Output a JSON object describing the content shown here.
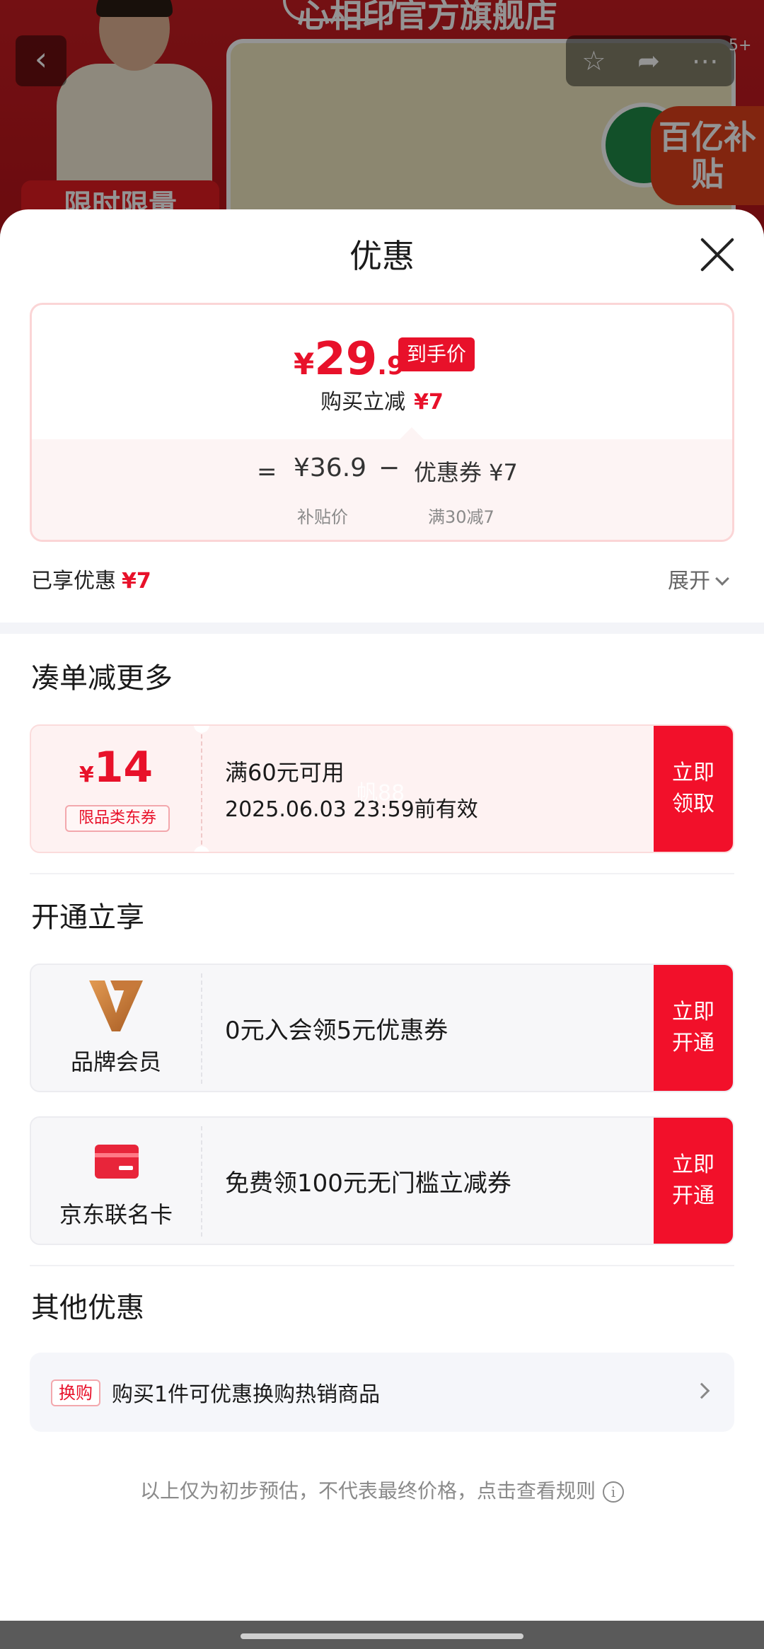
{
  "background": {
    "store_title": "心相印官方旗舰店",
    "flash_sale": "限时限量",
    "subsidy_badge": "百亿补贴",
    "tab_count": "5+"
  },
  "sheet": {
    "title": "优惠",
    "price_card": {
      "yen": "¥",
      "price_int": "29",
      "price_dec": ".9",
      "price_tag": "到手价",
      "instant_label": "购买立减",
      "instant_value": "¥7",
      "eq": "=",
      "subsidy_price": "¥36.9",
      "minus": "−",
      "coupon_value": "优惠券 ¥7",
      "subsidy_label": "补贴价",
      "coupon_label": "满30减7"
    },
    "enjoyed_label": "已享优惠",
    "enjoyed_value": "¥7",
    "expand_label": "展开"
  },
  "combo": {
    "title": "凑单减更多",
    "coupon": {
      "yen": "¥",
      "amount": "14",
      "tag": "限品类东券",
      "condition": "满60元可用",
      "validity": "2025.06.03 23:59前有效",
      "watermark": "帆88",
      "cta": "立即领取"
    }
  },
  "open": {
    "title": "开通立享",
    "items": [
      {
        "name": "品牌会员",
        "text": "0元入会领5元优惠券",
        "cta": "立即开通",
        "icon": "v-brand-icon"
      },
      {
        "name": "京东联名卡",
        "text": "免费领100元无门槛立减券",
        "cta": "立即开通",
        "icon": "credit-card-icon"
      }
    ]
  },
  "other": {
    "title": "其他优惠",
    "tag": "换购",
    "text": "购买1件可优惠换购热销商品"
  },
  "footnote": "以上仅为初步预估，不代表最终价格，点击查看规则",
  "colors": {
    "accent": "#e8112a",
    "cta": "#f2102a"
  }
}
